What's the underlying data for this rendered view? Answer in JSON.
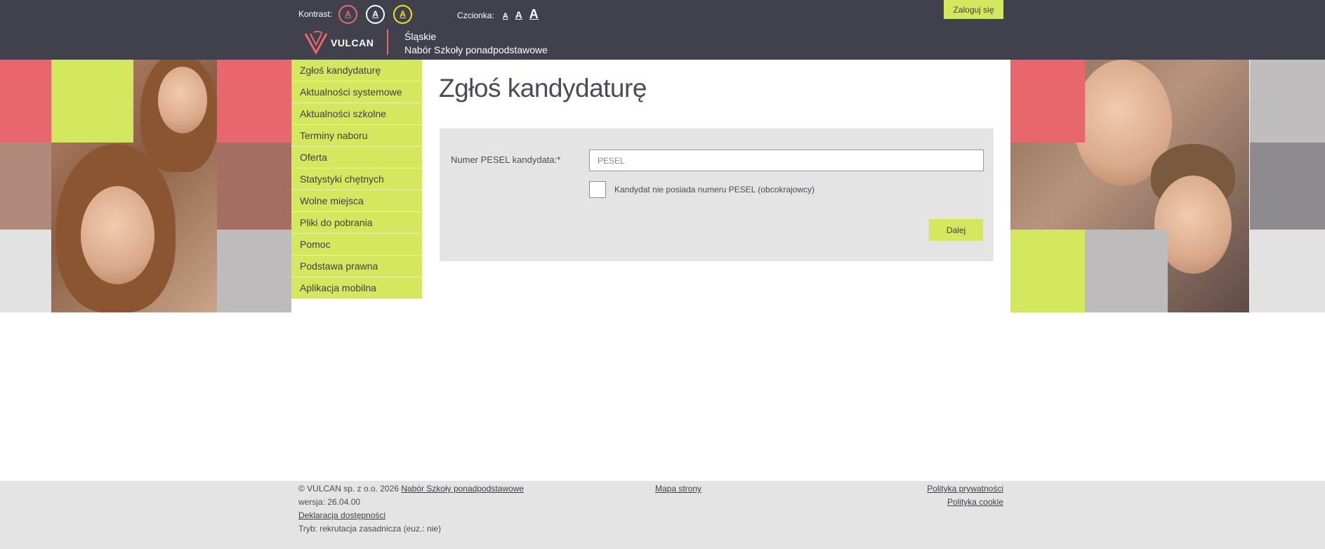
{
  "header": {
    "contrast_label": "Kontrast:",
    "contrast_buttons": [
      "A",
      "A",
      "A"
    ],
    "font_label": "Czcionka:",
    "font_buttons": [
      "A",
      "A",
      "A"
    ],
    "login_label": "Zaloguj się",
    "logo_text": "VULCAN",
    "region": "Śląskie",
    "app_name": "Nabór Szkoły ponadpodstawowe"
  },
  "sidebar": {
    "items": [
      {
        "label": "Zgłoś kandydaturę"
      },
      {
        "label": "Aktualności systemowe"
      },
      {
        "label": "Aktualności szkolne"
      },
      {
        "label": "Terminy naboru"
      },
      {
        "label": "Oferta"
      },
      {
        "label": "Statystyki chętnych"
      },
      {
        "label": "Wolne miejsca"
      },
      {
        "label": "Pliki do pobrania"
      },
      {
        "label": "Pomoc"
      },
      {
        "label": "Podstawa prawna"
      },
      {
        "label": "Aplikacja mobilna"
      }
    ]
  },
  "main": {
    "title": "Zgłoś kandydaturę",
    "pesel_label": "Numer PESEL kandydata:*",
    "pesel_placeholder": "PESEL",
    "pesel_value": "",
    "no_pesel_label": "Kandydat nie posiada numeru PESEL (obcokrajowcy)",
    "no_pesel_checked": false,
    "next_label": "Dalej"
  },
  "footer": {
    "copyright": "© VULCAN sp. z o.o. 2026",
    "app_link": "Nabór Szkoły ponadpodstawowe",
    "version": "wersja: 26.04.00",
    "accessibility_link": "Deklaracja dostępności",
    "mode": "Tryb: rekrutacja zasadnicza (euz.: nie)",
    "sitemap_link": "Mapa strony",
    "privacy_link": "Polityka prywatności",
    "cookie_link": "Polityka cookie"
  },
  "colors": {
    "header_bg": "#40414c",
    "accent_green": "#d3e85e",
    "accent_red": "#e8676f",
    "panel_gray": "#e4e4e4"
  }
}
